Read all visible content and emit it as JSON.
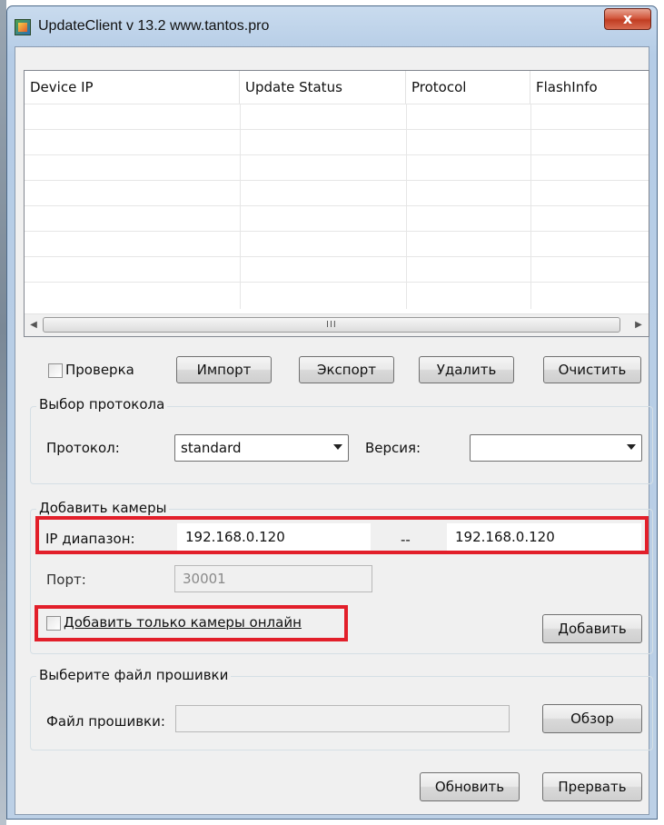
{
  "window": {
    "title": "UpdateClient v 13.2 www.tantos.pro",
    "close_glyph": "x"
  },
  "list": {
    "columns": [
      "Device IP",
      "Update Status",
      "Protocol",
      "FlashInfo"
    ],
    "scroll_grip": "III"
  },
  "toolbar": {
    "check_label": "Проверка",
    "import_label": "Импорт",
    "export_label": "Экспорт",
    "delete_label": "Удалить",
    "clear_label": "Очистить"
  },
  "protocol_group": {
    "title": "Выбор протокола",
    "protocol_label": "Протокол:",
    "protocol_value": "standard",
    "version_label": "Версия:",
    "version_value": ""
  },
  "add_group": {
    "title": "Добавить камеры",
    "ip_range_label": "IP диапазон:",
    "ip_from": "192.168.0.120",
    "separator": "--",
    "ip_to": "192.168.0.120",
    "port_label": "Порт:",
    "port_value": "30001",
    "online_only_label": "Добавить только камеры онлайн",
    "add_button": "Добавить"
  },
  "firmware_group": {
    "title": "Выберите файл прошивки",
    "file_label": "Файл прошивки:",
    "file_value": "",
    "browse_button": "Обзор"
  },
  "footer": {
    "update_button": "Обновить",
    "abort_button": "Прервать"
  },
  "colors": {
    "highlight": "#e21f2a",
    "titlebar": "#bcd0e6",
    "close": "#c13d22"
  }
}
